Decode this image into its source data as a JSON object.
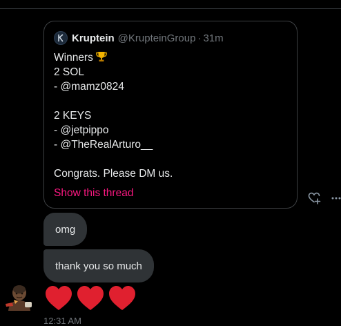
{
  "quoted_tweet": {
    "author_name": "Kruptein",
    "author_handle": "@KrupteinGroup",
    "separator": "·",
    "time_ago": "31m",
    "avatar_letter": "K",
    "lines": [
      "Winners",
      "2 SOL",
      "- @mamz0824",
      "",
      "2 KEYS",
      "- @jetpippo",
      "- @TheRealArturo__",
      "",
      "Congrats. Please DM us."
    ],
    "show_thread_label": "Show this thread"
  },
  "messages": [
    {
      "text": "omg"
    },
    {
      "text": "thank you so much"
    }
  ],
  "reaction_emoji_count": 3,
  "timestamp": "12:31 AM",
  "colors": {
    "accent": "#f91880",
    "bubble": "#2f3336",
    "heart": "#e0202f",
    "muted": "#71767b"
  }
}
